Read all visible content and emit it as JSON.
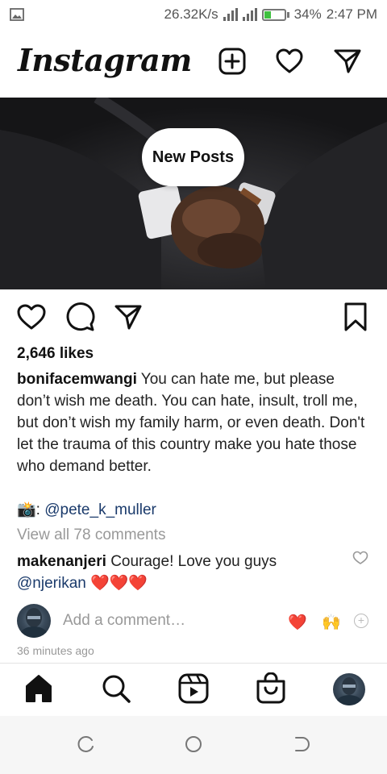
{
  "status_bar": {
    "speed": "26.32K/s",
    "battery": "34%",
    "time": "2:47 PM",
    "battery_level": 0.34
  },
  "header": {
    "logo": "Instagram",
    "icons": [
      "new-post-icon",
      "heart-icon",
      "direct-message-icon"
    ]
  },
  "post": {
    "new_posts_label": "New Posts",
    "likes": "2,646 likes",
    "author": "bonifacemwangi",
    "caption": "You can hate me, but please don’t wish me death. You can hate, insult, troll me, but don’t wish my family harm, or even death. Don't let the trauma of this country make you hate those who demand better.",
    "camera_emoji": "📸",
    "credit_sep": ": ",
    "credit_mention": "@pete_k_muller",
    "view_all": "View all 78 comments",
    "comment": {
      "user": "makenanjeri",
      "text": "Courage! Love you guys",
      "mention": "@njerikan",
      "hearts": "❤️❤️❤️"
    },
    "add_comment_placeholder": "Add a comment…",
    "quick_reactions": [
      "❤️",
      "🙌"
    ],
    "posted_time": "36 minutes ago"
  },
  "bottom_nav": [
    "home-icon",
    "search-icon",
    "reels-icon",
    "shop-icon",
    "profile-avatar"
  ],
  "colors": {
    "mention": "#1a3a6b",
    "muted": "#999999",
    "battery_charge": "#40c040"
  }
}
